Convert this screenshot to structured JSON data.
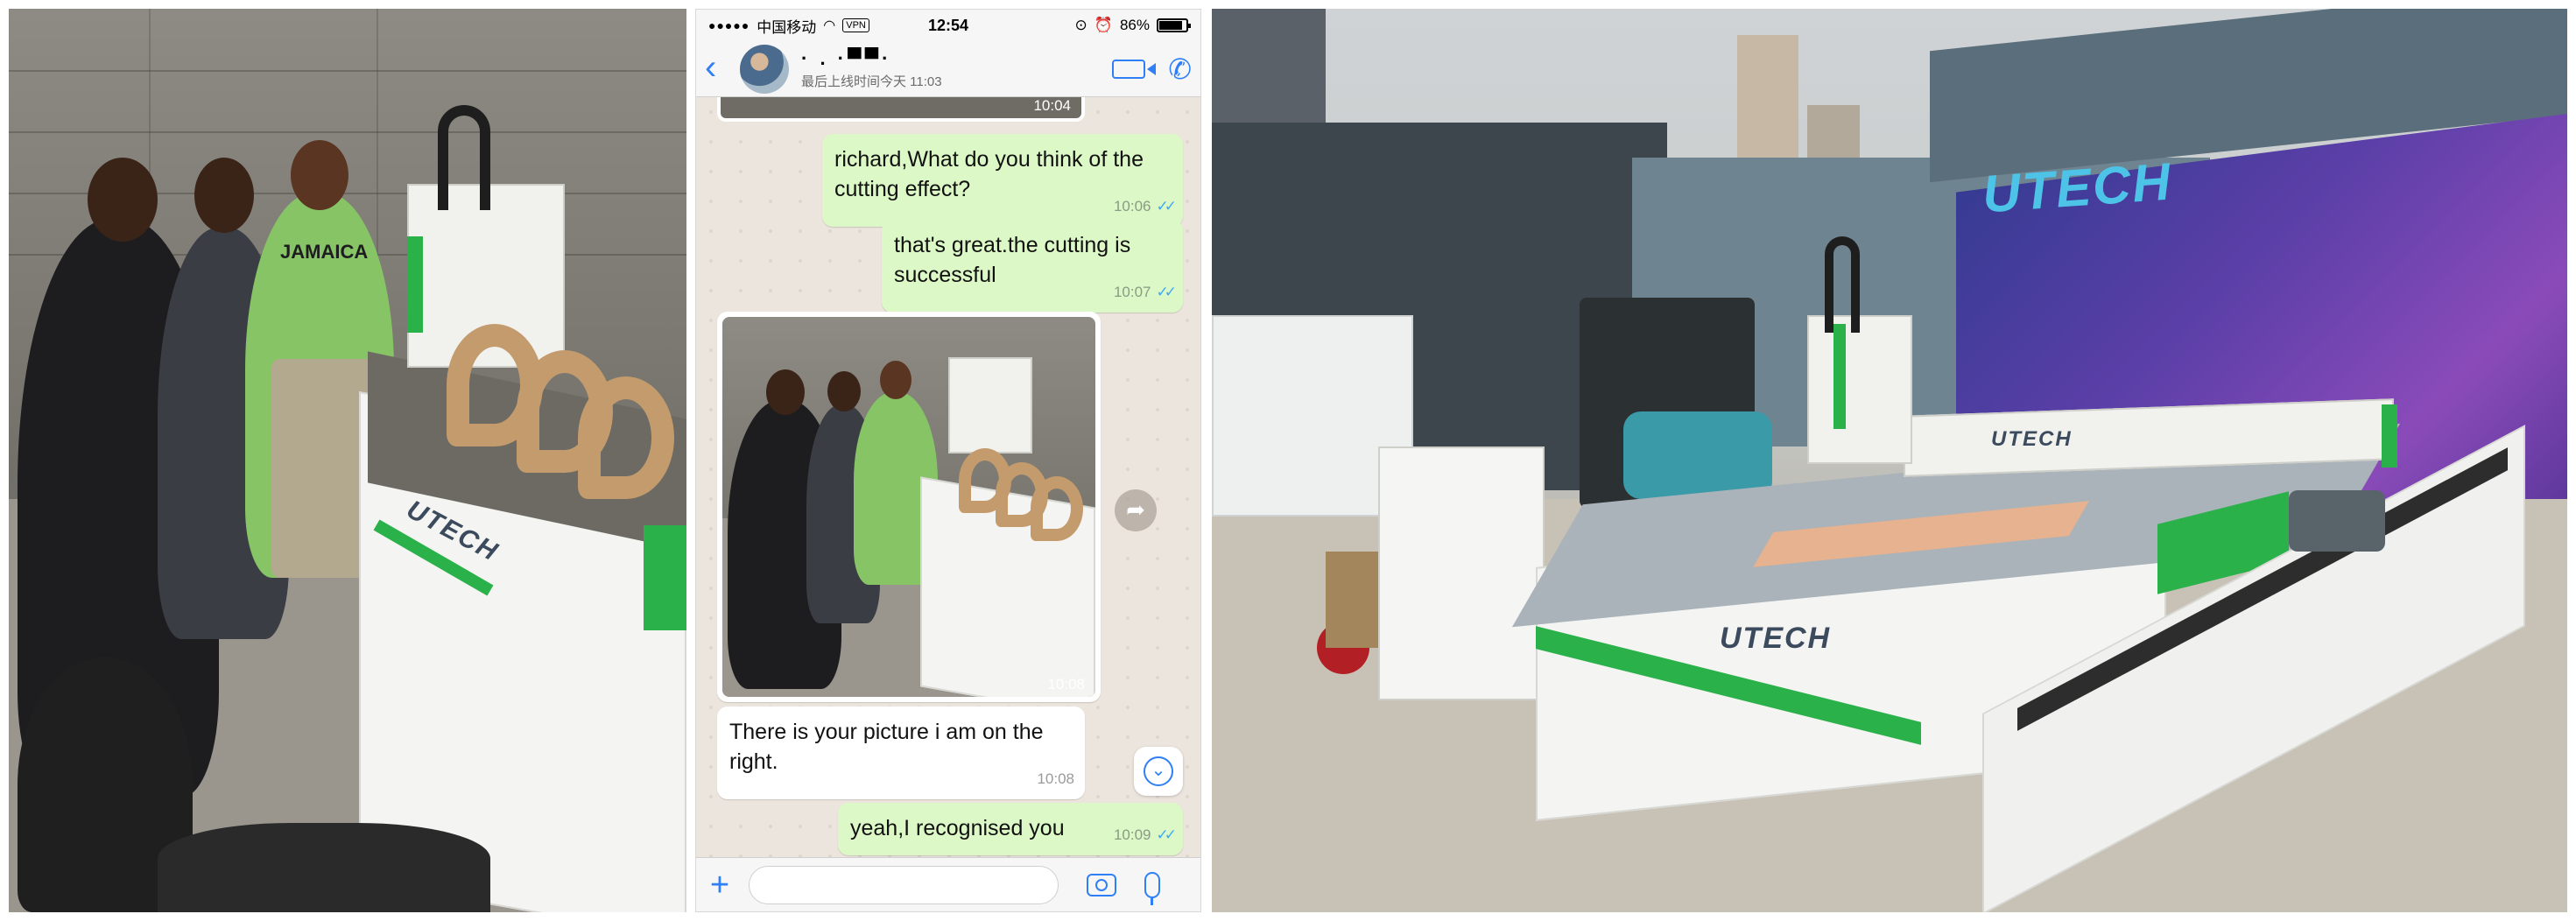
{
  "status_bar": {
    "signal": "●●●●●",
    "carrier": "中国移动",
    "wifi_icon": "wifi-icon",
    "vpn": "VPN",
    "time": "12:54",
    "battery_percent": "86%",
    "battery_level": 0.86
  },
  "chat_header": {
    "contact_name": "· .    ·▀▀·",
    "last_seen": "最后上线时间今天 11:03"
  },
  "messages": {
    "prev_image_time": "10:04",
    "m1": {
      "text": "richard,What do you think of the cutting effect?",
      "time": "10:06"
    },
    "m2": {
      "text": "that's great.the cutting is successful",
      "time": "10:07"
    },
    "photo": {
      "time": "10:08"
    },
    "m3": {
      "text": "There is your picture i am on the right.",
      "time": "10:08"
    },
    "m4": {
      "text": "yeah,I recognised you",
      "time": "10:09"
    }
  },
  "left_photo": {
    "shirt_text": "JAMAICA",
    "machine_brand": "UTECH"
  },
  "right_photo": {
    "tarp_brand": "UTECH",
    "gantry_brand": "UTECH",
    "machine_brand": "UTECH"
  },
  "colors": {
    "accent_blue": "#2f7ff6",
    "outgoing_bubble": "#dcf8c6",
    "machine_green": "#2bb14a"
  }
}
